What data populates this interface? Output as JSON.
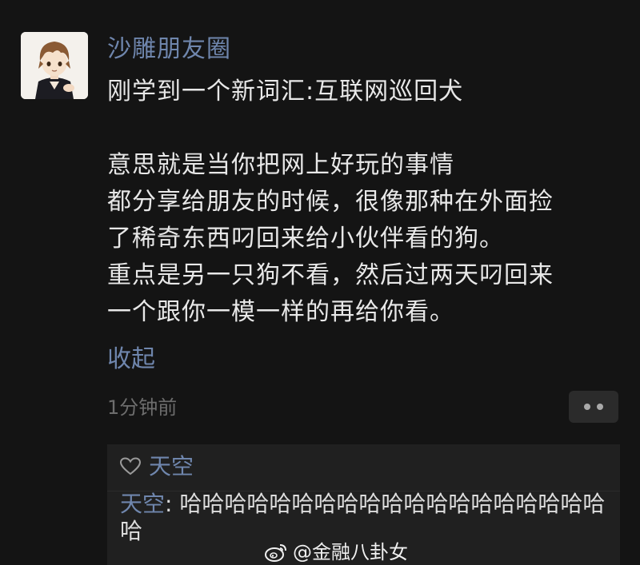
{
  "post": {
    "username": "沙雕朋友圈",
    "content_lines": [
      "刚学到一个新词汇:互联网巡回犬",
      "",
      "意思就是当你把网上好玩的事情",
      "都分享给朋友的时候，很像那种在外面捡",
      "了稀奇东西叼回来给小伙伴看的狗。",
      "重点是另一只狗不看，然后过两天叼回来",
      "一个跟你一模一样的再给你看。"
    ],
    "collapse_label": "收起",
    "timestamp": "1分钟前"
  },
  "interactions": {
    "likes": [
      "天空"
    ],
    "comment": {
      "author": "天空",
      "separator": ": ",
      "text": "哈哈哈哈哈哈哈哈哈哈哈哈哈哈哈哈哈哈哈哈"
    }
  },
  "watermark": {
    "text": "@金融八卦女"
  },
  "colors": {
    "background": "#141414",
    "name_link": "#6f86ad",
    "text": "#e8e8e8",
    "muted": "#6d6d6d",
    "panel": "#202020"
  },
  "icons": [
    "avatar-image",
    "heart-icon",
    "more-options-icon",
    "weibo-logo-icon"
  ]
}
